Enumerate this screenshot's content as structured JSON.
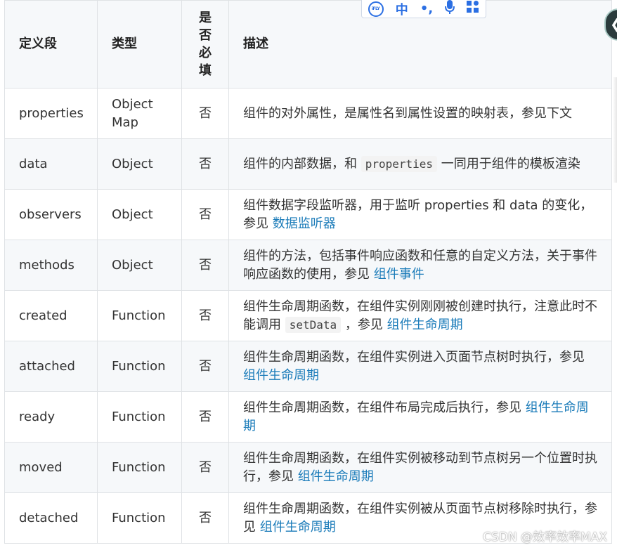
{
  "table": {
    "headers": {
      "field": "定义段",
      "type": "类型",
      "required": [
        "是",
        "否",
        "必",
        "填"
      ],
      "desc": "描述"
    },
    "rows": [
      {
        "field": "properties",
        "type": "Object Map",
        "required": "否",
        "desc": "组件的对外属性，是属性名到属性设置的映射表，参见下文",
        "code": "",
        "link": ""
      },
      {
        "field": "data",
        "type": "Object",
        "required": "否",
        "desc": "组件的内部数据，和",
        "code": "properties",
        "after": "一同用于组件的模板渲染",
        "link": ""
      },
      {
        "field": "observers",
        "type": "Object",
        "required": "否",
        "desc": "组件数据字段监听器，用于监听 properties 和 data 的变化，参见",
        "code": "",
        "link": "数据监听器"
      },
      {
        "field": "methods",
        "type": "Object",
        "required": "否",
        "desc": "组件的方法，包括事件响应函数和任意的自定义方法，关于事件响应函数的使用，参见",
        "code": "",
        "link": "组件事件"
      },
      {
        "field": "created",
        "type": "Function",
        "required": "否",
        "desc": "组件生命周期函数，在组件实例刚刚被创建时执行，注意此时不能调用",
        "code": "setData",
        "after": "，参见",
        "link": "组件生命周期"
      },
      {
        "field": "attached",
        "type": "Function",
        "required": "否",
        "desc": "组件生命周期函数，在组件实例进入页面节点树时执行，参见",
        "code": "",
        "link": "组件生命周期"
      },
      {
        "field": "ready",
        "type": "Function",
        "required": "否",
        "desc": "组件生命周期函数，在组件布局完成后执行，参见",
        "code": "",
        "link": "组件生命周期"
      },
      {
        "field": "moved",
        "type": "Function",
        "required": "否",
        "desc": "组件生命周期函数，在组件实例被移动到节点树另一个位置时执行，参见",
        "code": "",
        "link": "组件生命周期"
      },
      {
        "field": "detached",
        "type": "Function",
        "required": "否",
        "desc": "组件生命周期函数，在组件实例被从页面节点树移除时执行，参见",
        "code": "",
        "link": "组件生命周期"
      }
    ]
  },
  "ime_toolbar": {
    "logo": "iFLY",
    "lang": "中",
    "punct": "•,",
    "mic": "🎤",
    "apps": "▦"
  },
  "side_tab": {
    "glyph": "❮"
  },
  "watermark": "CSDN @效率效率MAX"
}
